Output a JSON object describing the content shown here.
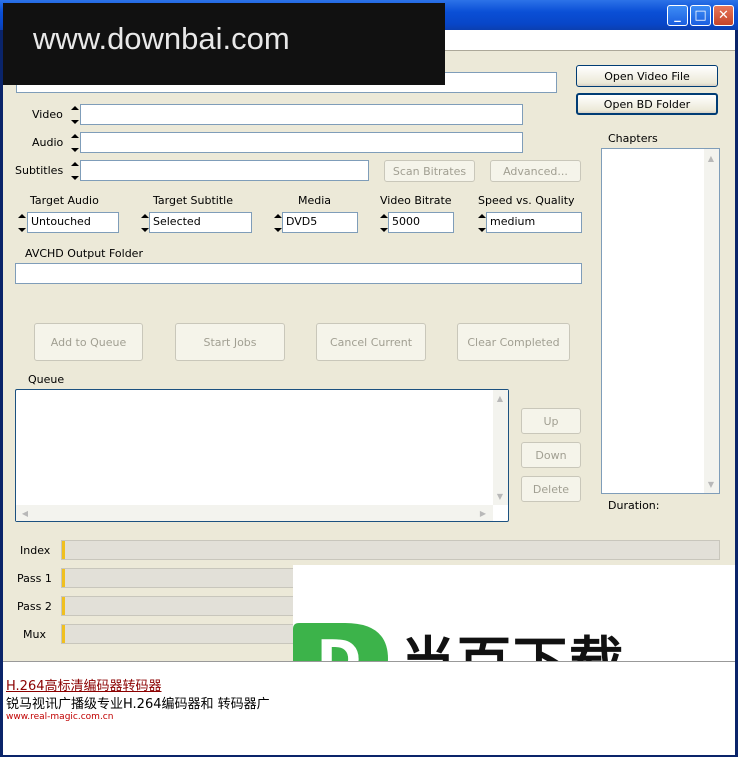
{
  "window": {
    "minimize": "_",
    "maximize": "□",
    "close": "✕"
  },
  "watermark": "www.downbai.com",
  "source": {
    "open_video_label": "Open Video File",
    "open_bd_label": "Open BD Folder"
  },
  "streams": {
    "video_label": "Video",
    "audio_label": "Audio",
    "subtitles_label": "Subtitles",
    "scan_label": "Scan Bitrates",
    "advanced_label": "Advanced..."
  },
  "options": {
    "target_audio": {
      "label": "Target Audio",
      "value": "Untouched"
    },
    "target_subtitle": {
      "label": "Target Subtitle",
      "value": "Selected"
    },
    "media": {
      "label": "Media",
      "value": "DVD5"
    },
    "video_bitrate": {
      "label": "Video Bitrate",
      "value": "5000"
    },
    "speed_quality": {
      "label": "Speed vs. Quality",
      "value": "medium"
    }
  },
  "output": {
    "label": "AVCHD Output Folder",
    "value": ""
  },
  "actions": {
    "add": "Add to Queue",
    "start": "Start Jobs",
    "cancel": "Cancel Current",
    "clear": "Clear Completed"
  },
  "queue": {
    "label": "Queue",
    "up": "Up",
    "down": "Down",
    "delete": "Delete"
  },
  "chapters": {
    "label": "Chapters",
    "duration_label": "Duration:"
  },
  "progress": {
    "index": {
      "label": "Index",
      "value": 0
    },
    "pass1": {
      "label": "Pass 1",
      "value": 0
    },
    "pass2": {
      "label": "Pass 2",
      "value": 0
    },
    "mux": {
      "label": "Mux",
      "value": 0
    }
  },
  "ad": {
    "logo_letter": "D",
    "logo_text": "当百下载",
    "line1": "H.264高标清编码器转码器",
    "line2": "锐马视讯广播级专业H.264编码器和 转码器广",
    "url": "www.real-magic.com.cn"
  },
  "colors": {
    "accent": "#003c74",
    "progress_marker": "#f0c020",
    "ad_green": "#3cb34a"
  }
}
